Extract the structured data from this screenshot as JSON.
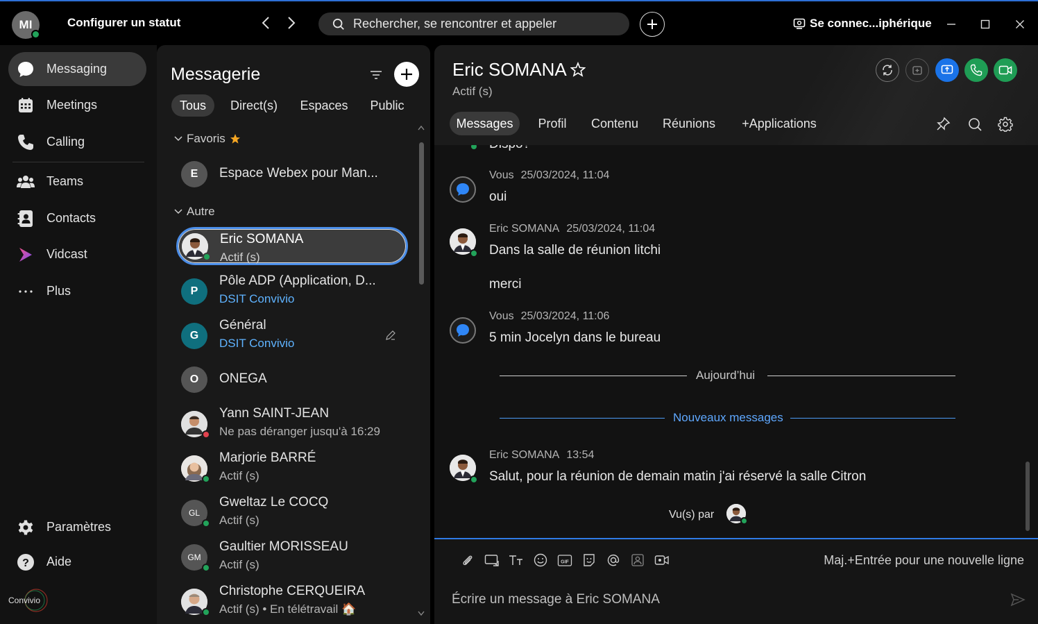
{
  "titlebar": {
    "avatar_initials": "MI",
    "status_label": "Configurer un statut",
    "back_glyph": "‹",
    "forward_glyph": "›",
    "search_placeholder": "Rechercher, se rencontrer et appeler",
    "add_glyph": "+",
    "device_label": "Se connec...iphérique"
  },
  "leftnav": {
    "items": [
      {
        "label": "Messaging",
        "icon": "chat-bubble-icon"
      },
      {
        "label": "Meetings",
        "icon": "calendar-icon"
      },
      {
        "label": "Calling",
        "icon": "phone-icon"
      },
      {
        "label": "Teams",
        "icon": "people-icon"
      },
      {
        "label": "Contacts",
        "icon": "contact-card-icon"
      },
      {
        "label": "Vidcast",
        "icon": "vidcast-icon"
      },
      {
        "label": "Plus",
        "icon": "more-dots-icon"
      }
    ],
    "bottom": [
      {
        "label": "Paramètres",
        "icon": "gear-icon"
      },
      {
        "label": "Aide",
        "icon": "help-icon"
      }
    ],
    "logo_text": "Convivio"
  },
  "messaging": {
    "title": "Messagerie",
    "tabs": [
      "Tous",
      "Direct(s)",
      "Espaces",
      "Public"
    ],
    "favorites_label": "Favoris",
    "other_label": "Autre",
    "favorites": [
      {
        "name": "Espace Webex pour Man...",
        "initial": "E",
        "color": "#555555"
      }
    ],
    "contacts": [
      {
        "name": "Eric SOMANA",
        "sub": "Actif (s)",
        "presence": "#22a35a"
      },
      {
        "name": "Pôle ADP (Application, D...",
        "sub": "DSIT Convivio",
        "initial": "P",
        "color": "#0f6f7e"
      },
      {
        "name": "Général",
        "sub": "DSIT Convivio",
        "initial": "G",
        "color": "#0f6f7e"
      },
      {
        "name": "ONEGA",
        "initial": "O",
        "color": "#555555"
      },
      {
        "name": "Yann SAINT-JEAN",
        "sub": "Ne pas déranger jusqu'à 16:29",
        "presence": "#e0424e"
      },
      {
        "name": "Marjorie BARRÉ",
        "sub": "Actif (s)",
        "presence": "#22a35a"
      },
      {
        "name": "Gweltaz Le COCQ",
        "sub": "Actif (s)",
        "initial": "GL",
        "color": "#555555",
        "presence": "#22a35a"
      },
      {
        "name": "Gaultier MORISSEAU",
        "sub": "Actif (s)",
        "initial": "GM",
        "color": "#555555",
        "presence": "#22a35a"
      },
      {
        "name": "Christophe CERQUEIRA",
        "sub": "Actif (s) • En télétravail 🏠",
        "presence": "#22a35a"
      }
    ]
  },
  "chat": {
    "name": "Eric SOMANA",
    "status": "Actif (s)",
    "tabs": [
      "Messages",
      "Profil",
      "Contenu",
      "Réunions",
      "+Applications"
    ],
    "partial_text": "Dispo?",
    "messages": [
      {
        "author": "Vous",
        "time": "25/03/2024, 11:04",
        "text": "oui"
      },
      {
        "author": "Eric SOMANA",
        "time": "25/03/2024, 11:04",
        "text": "Dans la salle de réunion litchi",
        "text2": "merci"
      },
      {
        "author": "Vous",
        "time": "25/03/2024, 11:06",
        "text": "5 min Jocelyn dans le bureau"
      },
      {
        "author": "Eric SOMANA",
        "time": "13:54",
        "text": "Salut, pour la réunion de demain matin j'ai réservé la salle Citron"
      }
    ],
    "today_label": "Aujourd’hui",
    "new_messages_label": "Nouveaux messages",
    "seen_label": "Vu(s) par",
    "composer_hint": "Maj.+Entrée pour une nouvelle ligne",
    "composer_placeholder": "Écrire un message à Eric SOMANA",
    "accent": "#2f7be6",
    "new_line_color": "#5fa8ff"
  }
}
